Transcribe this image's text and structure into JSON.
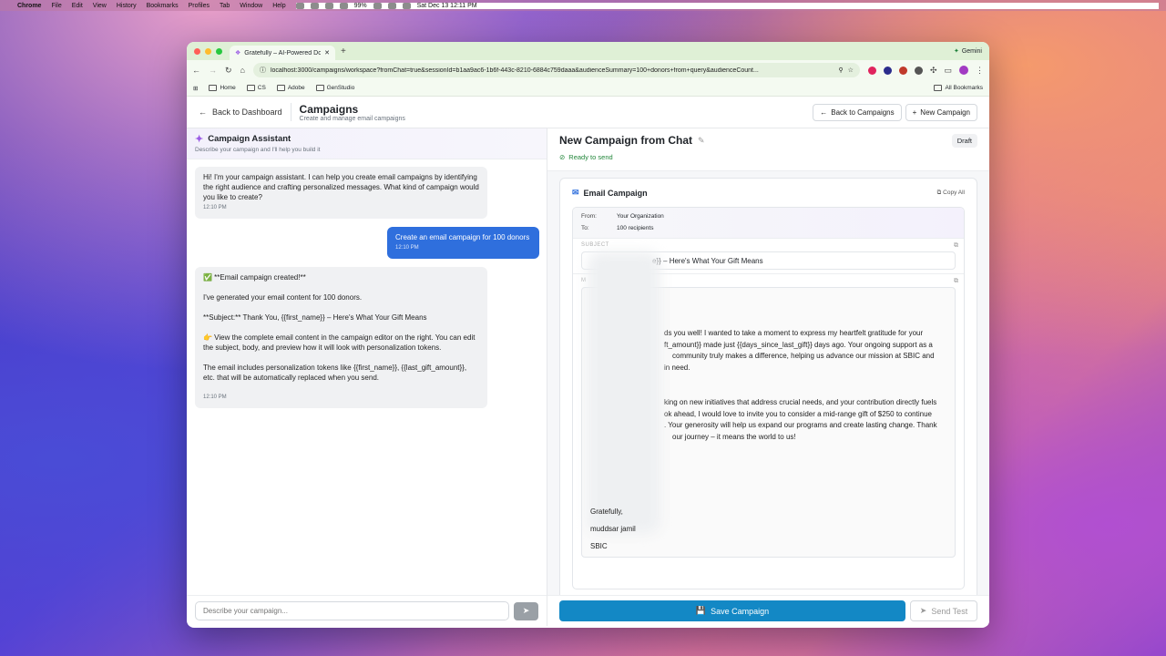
{
  "menubar": {
    "app": "Chrome",
    "items": [
      "File",
      "Edit",
      "View",
      "History",
      "Bookmarks",
      "Profiles",
      "Tab",
      "Window",
      "Help"
    ],
    "battery": "99%",
    "clock": "Sat Dec 13  12:11 PM"
  },
  "browser": {
    "tab_title": "Gratefully – AI-Powered Donor",
    "gemini_label": "Gemini",
    "url": "localhost:3000/campaigns/workspace?fromChat=true&sessionId=b1aa9ac6-1b6f-443c-8210-6884c759daaa&audienceSummary=100+donors+from+query&audienceCount...",
    "bookmarks": [
      "Home",
      "CS",
      "Adobe",
      "GenStudio"
    ],
    "all_bookmarks": "All Bookmarks"
  },
  "header": {
    "back_dashboard": "Back to Dashboard",
    "title": "Campaigns",
    "subtitle": "Create and manage email campaigns",
    "back_campaigns": "Back to Campaigns",
    "new_campaign": "New Campaign"
  },
  "assistant": {
    "title": "Campaign Assistant",
    "subtitle": "Describe your campaign and I'll help you build it",
    "messages": [
      {
        "text": "Hi! I'm your campaign assistant. I can help you create email campaigns by identifying the right audience and crafting personalized messages. What kind of campaign would you like to create?",
        "time": "12:10 PM"
      },
      {
        "text": "Create an email campaign for 100 donors",
        "time": "12:10 PM"
      },
      {
        "p1": "✅ **Email campaign created!**",
        "p2": "I've generated your email content for 100 donors.",
        "p3": "**Subject:** Thank You, {{first_name}} – Here's What Your Gift Means",
        "p4": "👉 View the complete email content in the campaign editor on the right. You can edit the subject, body, and preview how it will look with personalization tokens.",
        "p5": "The email includes personalization tokens like {{first_name}}, {{last_gift_amount}}, etc. that will be automatically replaced when you send.",
        "time": "12:10 PM"
      }
    ],
    "input_placeholder": "Describe your campaign..."
  },
  "campaign": {
    "title": "New Campaign from Chat",
    "status": "Ready to send",
    "badge": "Draft",
    "card_title": "Email Campaign",
    "copy_all": "Copy All",
    "from_label": "From:",
    "from_value": "Your Organization",
    "to_label": "To:",
    "to_value": "100 recipients",
    "subject_label": "SUBJECT",
    "subject_visible": "e}} – Here's What Your Gift Means",
    "body_label": "M",
    "body_p1_l1": "ds you well! I wanted to take a moment to express my heartfelt gratitude for your",
    "body_p1_l2": "ft_amount}} made just {{days_since_last_gift}} days ago. Your ongoing support as a",
    "body_p1_l3": "community truly makes a difference, helping us advance our mission at SBIC and",
    "body_p1_l4": "in need.",
    "body_p2_l1": "king on new initiatives that address crucial needs, and your contribution directly fuels",
    "body_p2_l2": "ok ahead, I would love to invite you to consider a mid-range gift of $250 to continue",
    "body_p2_l3": ". Your generosity will help us expand our programs and create lasting change. Thank",
    "body_p2_l4": "our journey – it means the world to us!",
    "sign_1": "Gratefully,",
    "sign_2": "muddsar jamil",
    "sign_3": "SBIC",
    "save_label": "Save Campaign",
    "test_label": "Send Test"
  },
  "colors": {
    "accent": "#1388c5",
    "user_bubble": "#2f6fdd",
    "ready": "#22863a"
  }
}
